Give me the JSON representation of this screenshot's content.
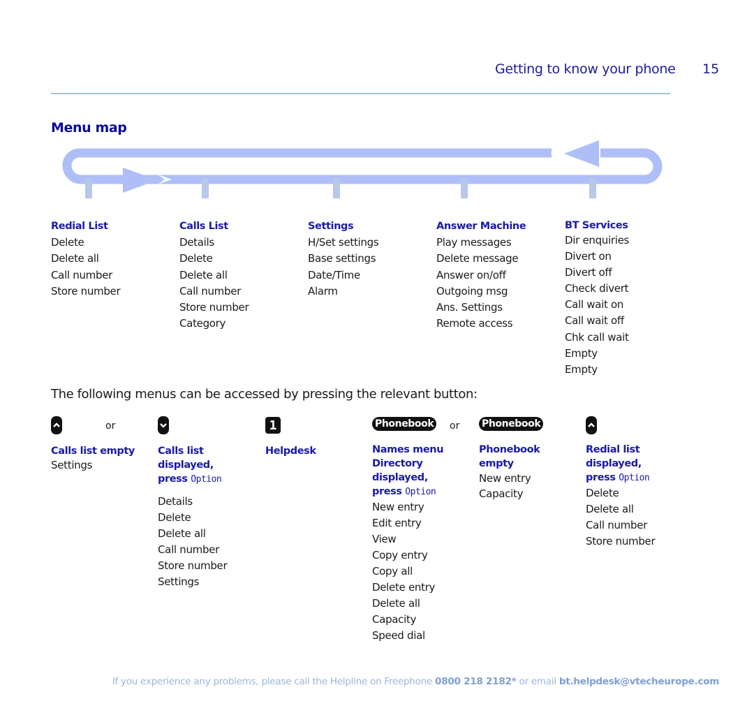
{
  "header": {
    "title": "Getting to know your phone",
    "page_number": "15"
  },
  "section_title": "Menu map",
  "colors": {
    "heading_blue": "#1a1aa8",
    "loop_blue": "#aebff7",
    "tick_blue": "#b7c8ea",
    "footer_text": "#9cb5dc",
    "footer_bold": "#7f9fd4"
  },
  "menu_columns": [
    {
      "title": "Redial List",
      "items": [
        "Delete",
        "Delete all",
        "Call number",
        "Store number"
      ]
    },
    {
      "title": "Calls List",
      "items": [
        "Details",
        "Delete",
        "Delete all",
        "Call number",
        "Store number",
        "Category"
      ]
    },
    {
      "title": "Settings",
      "items": [
        "H/Set settings",
        "Base settings",
        "Date/Time",
        "Alarm"
      ]
    },
    {
      "title": "Answer Machine",
      "items": [
        "Play messages",
        "Delete message",
        "Answer on/off",
        "Outgoing msg",
        "Ans. Settings",
        "Remote access"
      ]
    },
    {
      "title": "BT Services",
      "items": [
        "Dir enquiries",
        "Divert on",
        "Divert off",
        "Check divert",
        "Call wait on",
        "Call wait off",
        "Chk call wait",
        "Empty",
        "Empty"
      ]
    }
  ],
  "intro_text": "The following menus can be accessed by pressing the relevant button:",
  "or_label": "or",
  "buttons": {
    "up_icon": "up-arrow-key",
    "down_icon": "down-arrow-key",
    "one_key": "1",
    "phonebook_key": "Phonebook"
  },
  "press_word": "press",
  "option_word": "Option",
  "shortcut_blocks": [
    {
      "heading_lines": [
        "Calls list empty"
      ],
      "has_option": false,
      "items": [
        "Settings"
      ]
    },
    {
      "heading_lines": [
        "Calls list",
        "displayed,"
      ],
      "has_option": true,
      "items": [
        "Details",
        "Delete",
        "Delete all",
        "Call number",
        "Store number",
        "Settings"
      ]
    },
    {
      "heading_lines": [
        "Helpdesk"
      ],
      "has_option": false,
      "items": []
    },
    {
      "heading_lines": [
        "Names menu",
        "Directory",
        "displayed,"
      ],
      "has_option": true,
      "items": [
        "New entry",
        "Edit entry",
        "View",
        "Copy entry",
        "Copy all",
        "Delete entry",
        "Delete all",
        "Capacity",
        "Speed dial"
      ]
    },
    {
      "heading_lines": [
        "Phonebook",
        "empty"
      ],
      "has_option": false,
      "items": [
        "New entry",
        "Capacity"
      ]
    },
    {
      "heading_lines": [
        "Redial list",
        "displayed,"
      ],
      "has_option": true,
      "items": [
        "Delete",
        "Delete all",
        "Call number",
        "Store number"
      ]
    }
  ],
  "footer": {
    "text_before": "If you experience any problems, please call the Helpline on Freephone ",
    "phone": "0800 218 2182*",
    "text_middle": " or email ",
    "email": "bt.helpdesk@vtecheurope.com"
  }
}
